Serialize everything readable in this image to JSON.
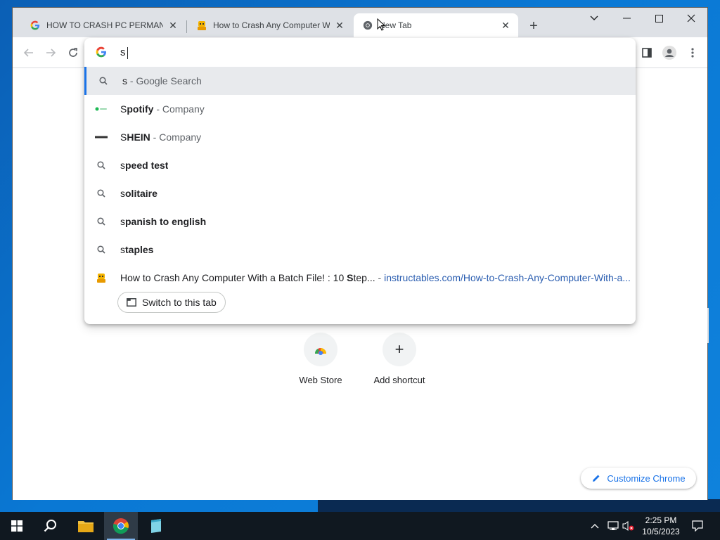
{
  "browser": {
    "tabs": [
      {
        "title": "HOW TO CRASH PC PERMANENTLY",
        "favicon": "google-g-icon"
      },
      {
        "title": "How to Crash Any Computer With",
        "favicon": "instructables-robot-icon"
      },
      {
        "title": "New Tab",
        "favicon": "chrome-icon",
        "active": true
      }
    ],
    "window_controls": [
      "tab-search",
      "minimize",
      "maximize",
      "close"
    ]
  },
  "omnibox": {
    "input_value": "s",
    "suggestions": [
      {
        "icon": "search-icon",
        "typed": "s",
        "rest": "",
        "suffix": " - Google Search",
        "selected": true
      },
      {
        "icon": "spotify-logo",
        "typed": "S",
        "rest": "potify",
        "suffix": " - Company"
      },
      {
        "icon": "shein-logo",
        "typed": "S",
        "rest": "HEIN",
        "suffix": " - Company"
      },
      {
        "icon": "search-icon",
        "typed": "s",
        "rest": "peed test",
        "suffix": ""
      },
      {
        "icon": "search-icon",
        "typed": "s",
        "rest": "olitaire",
        "suffix": ""
      },
      {
        "icon": "search-icon",
        "typed": "s",
        "rest": "panish to english",
        "suffix": ""
      },
      {
        "icon": "search-icon",
        "typed": "s",
        "rest": "taples",
        "suffix": ""
      }
    ],
    "tab_match": {
      "title_before": "How to Crash Any Computer With a Batch File! : 10 ",
      "title_bold": "S",
      "title_after": "tep...",
      "separator": " - ",
      "url": "instructables.com/How-to-Crash-Any-Computer-With-a..."
    },
    "switch_tab_label": "Switch to this tab"
  },
  "newtab": {
    "shortcuts": [
      {
        "label": "Web Store",
        "icon": "web-store-icon"
      },
      {
        "label": "Add shortcut",
        "icon": "plus-icon"
      }
    ],
    "customize_label": "Customize Chrome"
  },
  "taskbar": {
    "clock_time": "2:25 PM",
    "clock_date": "10/5/2023"
  },
  "colors": {
    "accent": "#1a73e8",
    "taskbar": "#101820",
    "desktop": "#0a78d4"
  }
}
